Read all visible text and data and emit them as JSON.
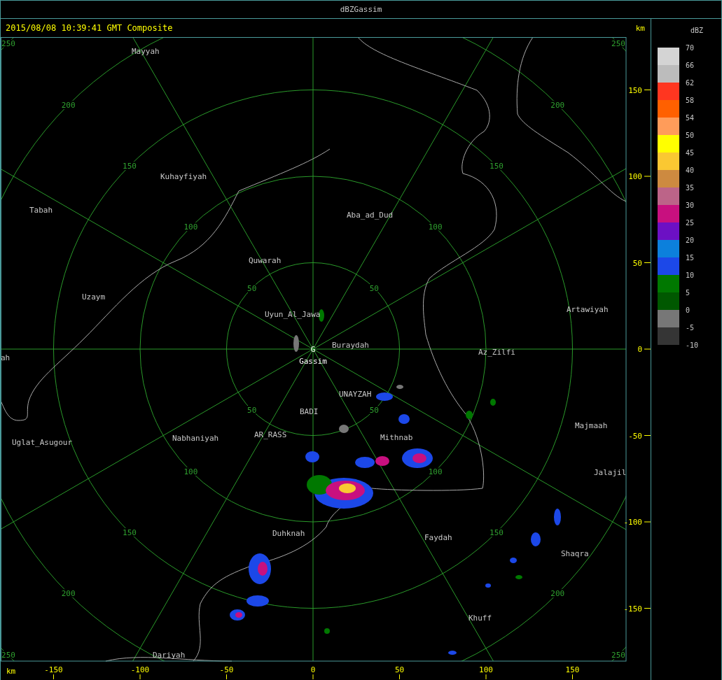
{
  "window": {
    "title": "dBZGassim"
  },
  "header": {
    "timestamp": "2015/08/08 10:39:41 GMT Composite",
    "unit": "km"
  },
  "radar": {
    "station": {
      "marker": "G",
      "name": "Gassim"
    },
    "cities": [
      {
        "name": "Mayyah"
      },
      {
        "name": "Kuhayfiyah"
      },
      {
        "name": "Tabah"
      },
      {
        "name": "Aba_ad_Dud"
      },
      {
        "name": "Quwarah"
      },
      {
        "name": "Uzaym"
      },
      {
        "name": "Uyun_Al_Jawa"
      },
      {
        "name": "Buraydah"
      },
      {
        "name": "Az_Zilfi"
      },
      {
        "name": "Artawiyah"
      },
      {
        "name": "ah"
      },
      {
        "name": "UNAYZAH"
      },
      {
        "name": "BADI"
      },
      {
        "name": "Majmaah"
      },
      {
        "name": "Uglat_Asugour"
      },
      {
        "name": "Nabhaniyah"
      },
      {
        "name": "AR_RASS"
      },
      {
        "name": "Mithnab"
      },
      {
        "name": "Jalajil"
      },
      {
        "name": "Duhknah"
      },
      {
        "name": "Faydah"
      },
      {
        "name": "Shaqra"
      },
      {
        "name": "Khuff"
      },
      {
        "name": "Dariyah"
      }
    ],
    "rings": [
      {
        "labels": [
          "50",
          "50",
          "50",
          "50"
        ]
      },
      {
        "labels": [
          "100",
          "100",
          "100",
          "100"
        ]
      },
      {
        "labels": [
          "150",
          "150",
          "150",
          "150"
        ]
      },
      {
        "labels": [
          "200",
          "200",
          "200",
          "200"
        ]
      },
      {
        "labels": [
          "250",
          "250",
          "250",
          "250"
        ]
      }
    ],
    "y_axis": {
      "ticks": [
        "150",
        "100",
        "50",
        "0",
        "-50",
        "-100",
        "-150"
      ]
    },
    "x_axis": {
      "unit": "km",
      "ticks": [
        "-150",
        "-100",
        "-50",
        "0",
        "50",
        "100",
        "150"
      ]
    }
  },
  "legend": {
    "title": "dBZ",
    "bottom_label": "-10",
    "bins": [
      {
        "label": "70",
        "color": "#d4d4d4"
      },
      {
        "label": "66",
        "color": "#bcbcbc"
      },
      {
        "label": "62",
        "color": "#ff3620"
      },
      {
        "label": "58",
        "color": "#ff6000"
      },
      {
        "label": "54",
        "color": "#ff9c5a"
      },
      {
        "label": "50",
        "color": "#ffff00"
      },
      {
        "label": "45",
        "color": "#fac832"
      },
      {
        "label": "40",
        "color": "#cd8a40"
      },
      {
        "label": "35",
        "color": "#bc6488"
      },
      {
        "label": "30",
        "color": "#c8107f"
      },
      {
        "label": "25",
        "color": "#6c10c4"
      },
      {
        "label": "20",
        "color": "#0c80dc"
      },
      {
        "label": "15",
        "color": "#1c48e8"
      },
      {
        "label": "10",
        "color": "#007800"
      },
      {
        "label": "5",
        "color": "#005800"
      },
      {
        "label": "0",
        "color": "#777777"
      },
      {
        "label": "-5",
        "color": "#353535"
      }
    ]
  }
}
